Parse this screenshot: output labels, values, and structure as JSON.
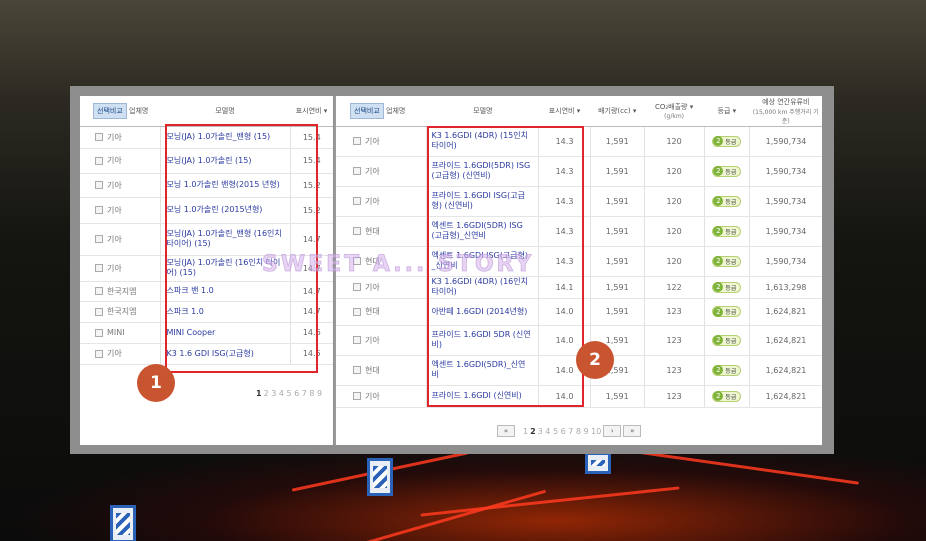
{
  "panel1": {
    "compare_label": "선택비교",
    "headers": {
      "maker": "업체명",
      "model": "모델명",
      "efficiency": "표시연비"
    },
    "rows": [
      {
        "maker": "기아",
        "model": "모닝(JA) 1.0가솔린_밴형 (15)",
        "eff": "15.4"
      },
      {
        "maker": "기아",
        "model": "모닝(JA) 1.0가솔린 (15)",
        "eff": "15.4"
      },
      {
        "maker": "기아",
        "model": "모닝 1.0가솔린 밴형(2015 년형)",
        "eff": "15.2"
      },
      {
        "maker": "기아",
        "model": "모닝 1.0가솔린 (2015년형)",
        "eff": "15.2"
      },
      {
        "maker": "기아",
        "model": "모닝(JA) 1.0가솔린_밴형 (16인치 타이어) (15)",
        "eff": "14.7"
      },
      {
        "maker": "기아",
        "model": "모닝(JA) 1.0가솔린 (16인치 타이어) (15)",
        "eff": "14.7"
      },
      {
        "maker": "한국지엠",
        "model": "스파크 밴 1.0",
        "eff": "14.7"
      },
      {
        "maker": "한국지엠",
        "model": "스파크 1.0",
        "eff": "14.7"
      },
      {
        "maker": "MINI",
        "model": "MINI Cooper",
        "eff": "14.6"
      },
      {
        "maker": "기아",
        "model": "K3 1.6 GDI ISG(고급형)",
        "eff": "14.5"
      }
    ],
    "pager": {
      "current": "1",
      "pages": "2 3 4 5 6 7 8 9"
    },
    "badge": "1"
  },
  "panel2": {
    "compare_label": "선택비교",
    "headers": {
      "maker": "업체명",
      "model": "모델명",
      "efficiency": "표시연비",
      "displacement": "배기량(cc)",
      "co2": "CO₂배출량",
      "co2_unit": "(g/km)",
      "grade": "등급",
      "fuel_cost": "예상 연간유류비",
      "fuel_cost_sub": "(15,000 km 주행거리 기준)"
    },
    "rows": [
      {
        "maker": "기아",
        "model": "K3 1.6GDI (4DR) (15인치 타이어)",
        "eff": "14.3",
        "cc": "1,591",
        "co2": "120",
        "grade_num": "2",
        "grade": "등급",
        "cost": "1,590,734"
      },
      {
        "maker": "기아",
        "model": "프라이드 1.6GDI(5DR) ISG (고급형) (신연비)",
        "eff": "14.3",
        "cc": "1,591",
        "co2": "120",
        "grade_num": "2",
        "grade": "등급",
        "cost": "1,590,734"
      },
      {
        "maker": "기아",
        "model": "프라이드 1.6GDI ISG(고급 형) (신연비)",
        "eff": "14.3",
        "cc": "1,591",
        "co2": "120",
        "grade_num": "2",
        "grade": "등급",
        "cost": "1,590,734"
      },
      {
        "maker": "현대",
        "model": "엑센트 1.6GDI(5DR) ISG (고급형)_신연비",
        "eff": "14.3",
        "cc": "1,591",
        "co2": "120",
        "grade_num": "2",
        "grade": "등급",
        "cost": "1,590,734"
      },
      {
        "maker": "현대",
        "model": "엑센트 1.6GDI ISG(고급형) _신연비",
        "eff": "14.3",
        "cc": "1,591",
        "co2": "120",
        "grade_num": "2",
        "grade": "등급",
        "cost": "1,590,734"
      },
      {
        "maker": "기아",
        "model": "K3 1.6GDI (4DR) (16인치 타이어)",
        "eff": "14.1",
        "cc": "1,591",
        "co2": "122",
        "grade_num": "2",
        "grade": "등급",
        "cost": "1,613,298"
      },
      {
        "maker": "현대",
        "model": "아반떼 1.6GDI (2014년형)",
        "eff": "14.0",
        "cc": "1,591",
        "co2": "123",
        "grade_num": "2",
        "grade": "등급",
        "cost": "1,624,821"
      },
      {
        "maker": "기아",
        "model": "프라이드 1.6GDI 5DR (신연 비)",
        "eff": "14.0",
        "cc": "1,591",
        "co2": "123",
        "grade_num": "2",
        "grade": "등급",
        "cost": "1,624,821"
      },
      {
        "maker": "현대",
        "model": "엑센트 1.6GDI(5DR)_신연 비",
        "eff": "14.0",
        "cc": "1,591",
        "co2": "123",
        "grade_num": "2",
        "grade": "등급",
        "cost": "1,624,821"
      },
      {
        "maker": "기아",
        "model": "프라이드 1.6GDI (신연비)",
        "eff": "14.0",
        "cc": "1,591",
        "co2": "123",
        "grade_num": "2",
        "grade": "등급",
        "cost": "1,624,821"
      }
    ],
    "pager": {
      "first": "«",
      "prev_pages": "1",
      "current": "2",
      "pages": "3 4 5 6 7 8 9 10",
      "next": "›",
      "last": "»"
    },
    "badge": "2"
  },
  "watermark": "SWEET A... STORY"
}
